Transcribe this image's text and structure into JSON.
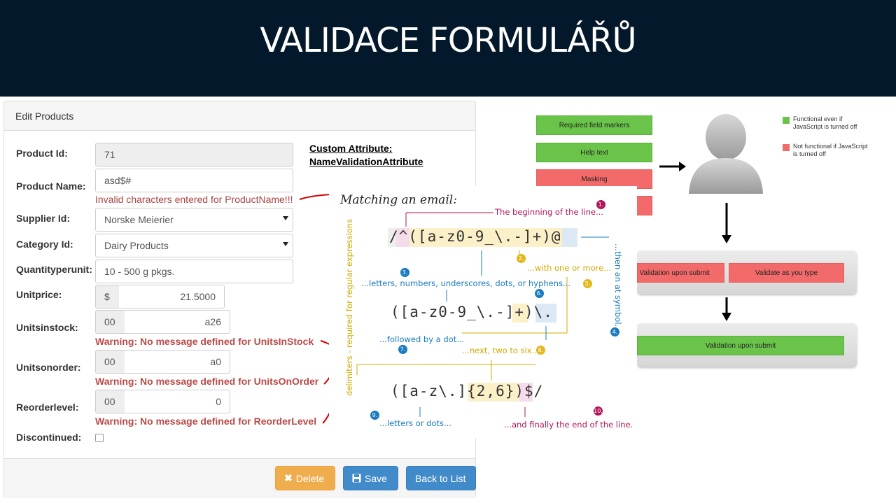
{
  "slide": {
    "title": "VALIDACE FORMULÁŘŮ"
  },
  "form": {
    "heading": "Edit Products",
    "custom_attribute": {
      "line1": "Custom Attribute:",
      "line2": "NameValidationAttribute"
    },
    "product_id": {
      "label": "Product Id:",
      "value": "71"
    },
    "product_name": {
      "label": "Product Name:",
      "value": "asd$#",
      "error": "Invalid characters entered for ProductName!!!"
    },
    "supplier_id": {
      "label": "Supplier Id:",
      "value": "Norske Meierier"
    },
    "category_id": {
      "label": "Category Id:",
      "value": "Dairy Products"
    },
    "quantity_per_unit": {
      "label": "Quantityperunit:",
      "value": "10 - 500 g pkgs."
    },
    "unit_price": {
      "label": "Unitprice:",
      "addon": "$",
      "value": "21.5000"
    },
    "units_in_stock": {
      "label": "Unitsinstock:",
      "addon": "00",
      "value": "a26",
      "warning": "Warning: No message defined for UnitsInStock"
    },
    "units_on_order": {
      "label": "Unitsonorder:",
      "addon": "00",
      "value": "a0",
      "warning": "Warning: No message defined for UnitsOnOrder"
    },
    "reorder_level": {
      "label": "Reorderlevel:",
      "addon": "00",
      "value": "0",
      "warning": "Warning: No message defined for ReorderLevel"
    },
    "discontinued": {
      "label": "Discontinued:",
      "checked": false
    },
    "buttons": {
      "delete": "Delete",
      "save": "Save",
      "back": "Back to List"
    }
  },
  "regex": {
    "title": "Matching an email:",
    "line1": "/^([a-z0-9_\\.-]+)@",
    "line2": "([a-z0-9_\\.-]+)\\.",
    "line3": "([a-z\\.]{2,6})$/",
    "side_left": "delimiters - required for regular expressions",
    "side_right": "...then an at symbol...",
    "notes": [
      {
        "num": "1.",
        "text": "The beginning of the line..."
      },
      {
        "num": "2.",
        "text": "...with one or more..."
      },
      {
        "num": "3.",
        "text": "...letters, numbers, underscores, dots, or hyphens..."
      },
      {
        "num": "4.",
        "text": ""
      },
      {
        "num": "5.",
        "text": ""
      },
      {
        "num": "6.",
        "text": ""
      },
      {
        "num": "7.",
        "text": "...followed by a dot..."
      },
      {
        "num": "8.",
        "text": "...next, two to six..."
      },
      {
        "num": "9.",
        "text": "...letters or dots..."
      },
      {
        "num": "10.",
        "text": "...and finally the end of the line."
      }
    ]
  },
  "diagram": {
    "boxes_top": [
      "Required field markers",
      "Help text",
      "Masking"
    ],
    "boxes_mid": [
      "Validation upon submit",
      "Validate as you type"
    ],
    "box_bottom": "Validation upon submit",
    "legend": {
      "functional": "Functional even if JavaScript is turned off",
      "not_functional": "Not functional if JavaScript is turned off"
    },
    "colors": {
      "functional": "#6bc44a",
      "not_functional": "#f26a6a"
    }
  }
}
